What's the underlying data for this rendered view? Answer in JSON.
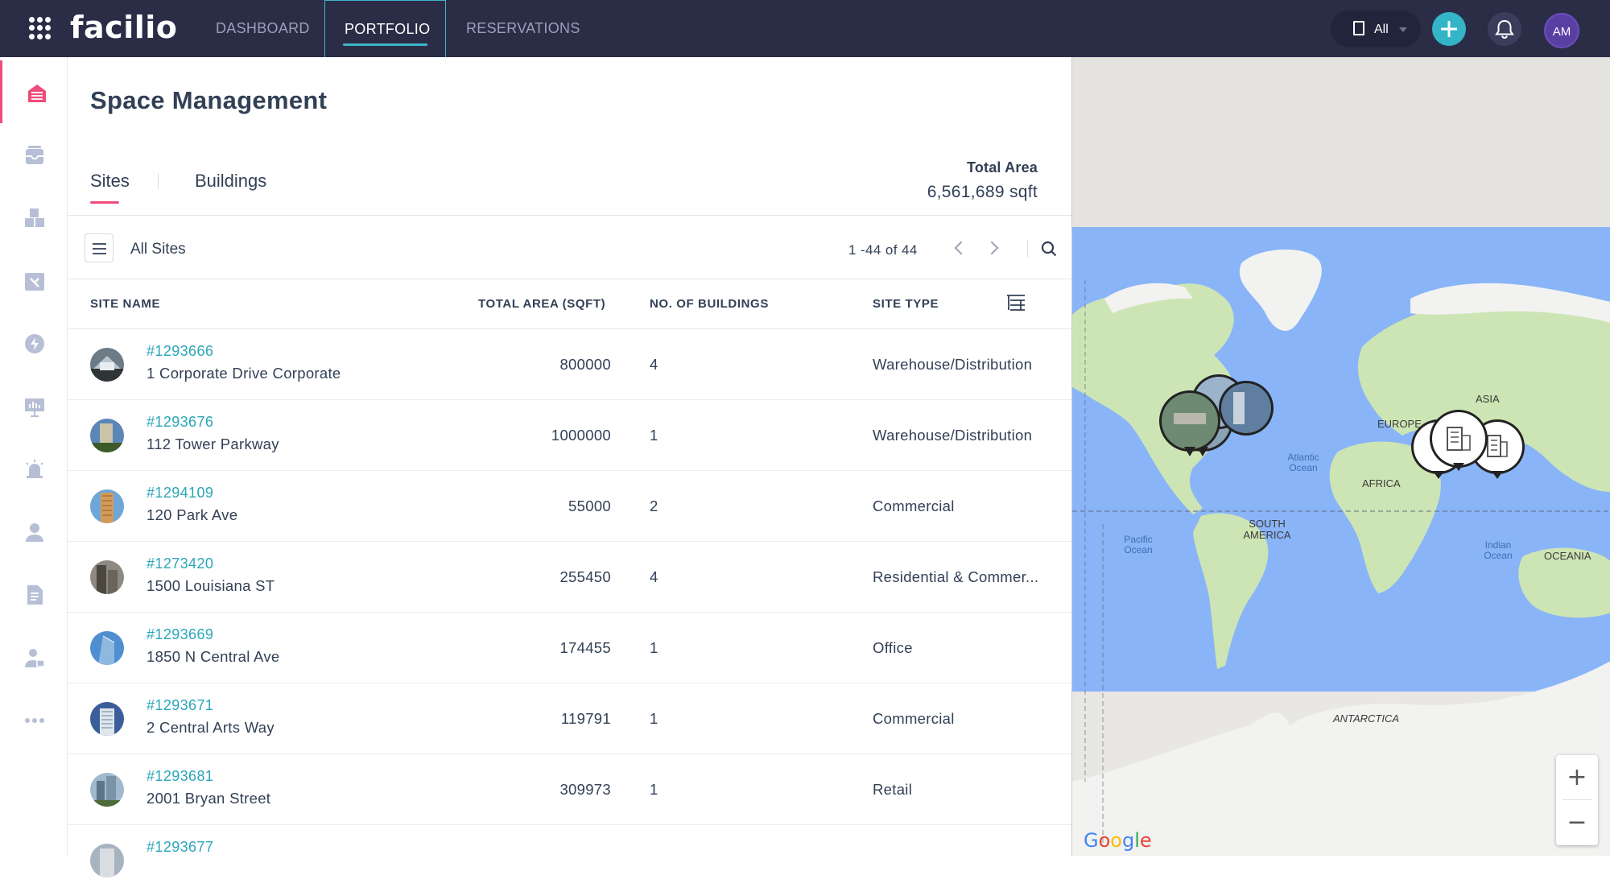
{
  "app": {
    "logo": "facilio"
  },
  "topnav": {
    "tabs": [
      {
        "label": "DASHBOARD"
      },
      {
        "label": "PORTFOLIO"
      },
      {
        "label": "RESERVATIONS"
      }
    ],
    "site_picker": "All",
    "user_initials": "AM"
  },
  "sidebar": {
    "items": [
      {
        "icon": "building-stack-icon",
        "active": true
      },
      {
        "icon": "inbox-tray-icon"
      },
      {
        "icon": "boxes-icon"
      },
      {
        "icon": "wrench-calendar-icon"
      },
      {
        "icon": "lightning-icon"
      },
      {
        "icon": "presentation-chart-icon"
      },
      {
        "icon": "alarm-siren-icon"
      },
      {
        "icon": "user-icon"
      },
      {
        "icon": "document-icon"
      },
      {
        "icon": "technician-icon"
      },
      {
        "icon": "more-icon"
      }
    ]
  },
  "page": {
    "title": "Space Management",
    "tabs": {
      "sites": "Sites",
      "buildings": "Buildings"
    },
    "total_area_label": "Total Area",
    "total_area_value": "6,561,689 sqft"
  },
  "toolbar": {
    "view_name": "All Sites",
    "pagination": "1 -44 of 44"
  },
  "table": {
    "headers": {
      "site_name": "SITE NAME",
      "total_area": "TOTAL AREA (SQFT)",
      "buildings": "NO. OF BUILDINGS",
      "site_type": "SITE TYPE"
    },
    "rows": [
      {
        "id": "#1293666",
        "name": "1 Corporate Drive Corporate",
        "area": "800000",
        "buildings": "4",
        "type": "Warehouse/Distribution"
      },
      {
        "id": "#1293676",
        "name": "112 Tower Parkway",
        "area": "1000000",
        "buildings": "1",
        "type": "Warehouse/Distribution"
      },
      {
        "id": "#1294109",
        "name": "120 Park Ave",
        "area": "55000",
        "buildings": "2",
        "type": "Commercial"
      },
      {
        "id": "#1273420",
        "name": "1500 Louisiana ST",
        "area": "255450",
        "buildings": "4",
        "type": "Residential & Commer..."
      },
      {
        "id": "#1293669",
        "name": "1850 N Central Ave",
        "area": "174455",
        "buildings": "1",
        "type": "Office"
      },
      {
        "id": "#1293671",
        "name": "2 Central Arts Way",
        "area": "119791",
        "buildings": "1",
        "type": "Commercial"
      },
      {
        "id": "#1293681",
        "name": "2001 Bryan Street",
        "area": "309973",
        "buildings": "1",
        "type": "Retail"
      },
      {
        "id": "#1293677",
        "name": "",
        "area": "",
        "buildings": "",
        "type": ""
      }
    ]
  },
  "map": {
    "labels": {
      "asia": "ASIA",
      "europe": "EUROPE",
      "africa": "AFRICA",
      "south_america_1": "SOUTH",
      "south_america_2": "AMERICA",
      "atlantic_1": "Atlantic",
      "atlantic_2": "Ocean",
      "pacific_1": "Pacific",
      "pacific_2": "Ocean",
      "indian_1": "Indian",
      "indian_2": "Ocean",
      "oceania": "OCEANIA",
      "antarctica": "ANTARCTICA"
    },
    "zoom_in": "+",
    "zoom_out": "−",
    "attribution": "Google"
  },
  "colors": {
    "topbar": "#2b2d47",
    "accent_pink": "#ef4c7a",
    "accent_teal": "#33b5c7",
    "ocean": "#8ab4f8",
    "land": "#cde5b4"
  }
}
